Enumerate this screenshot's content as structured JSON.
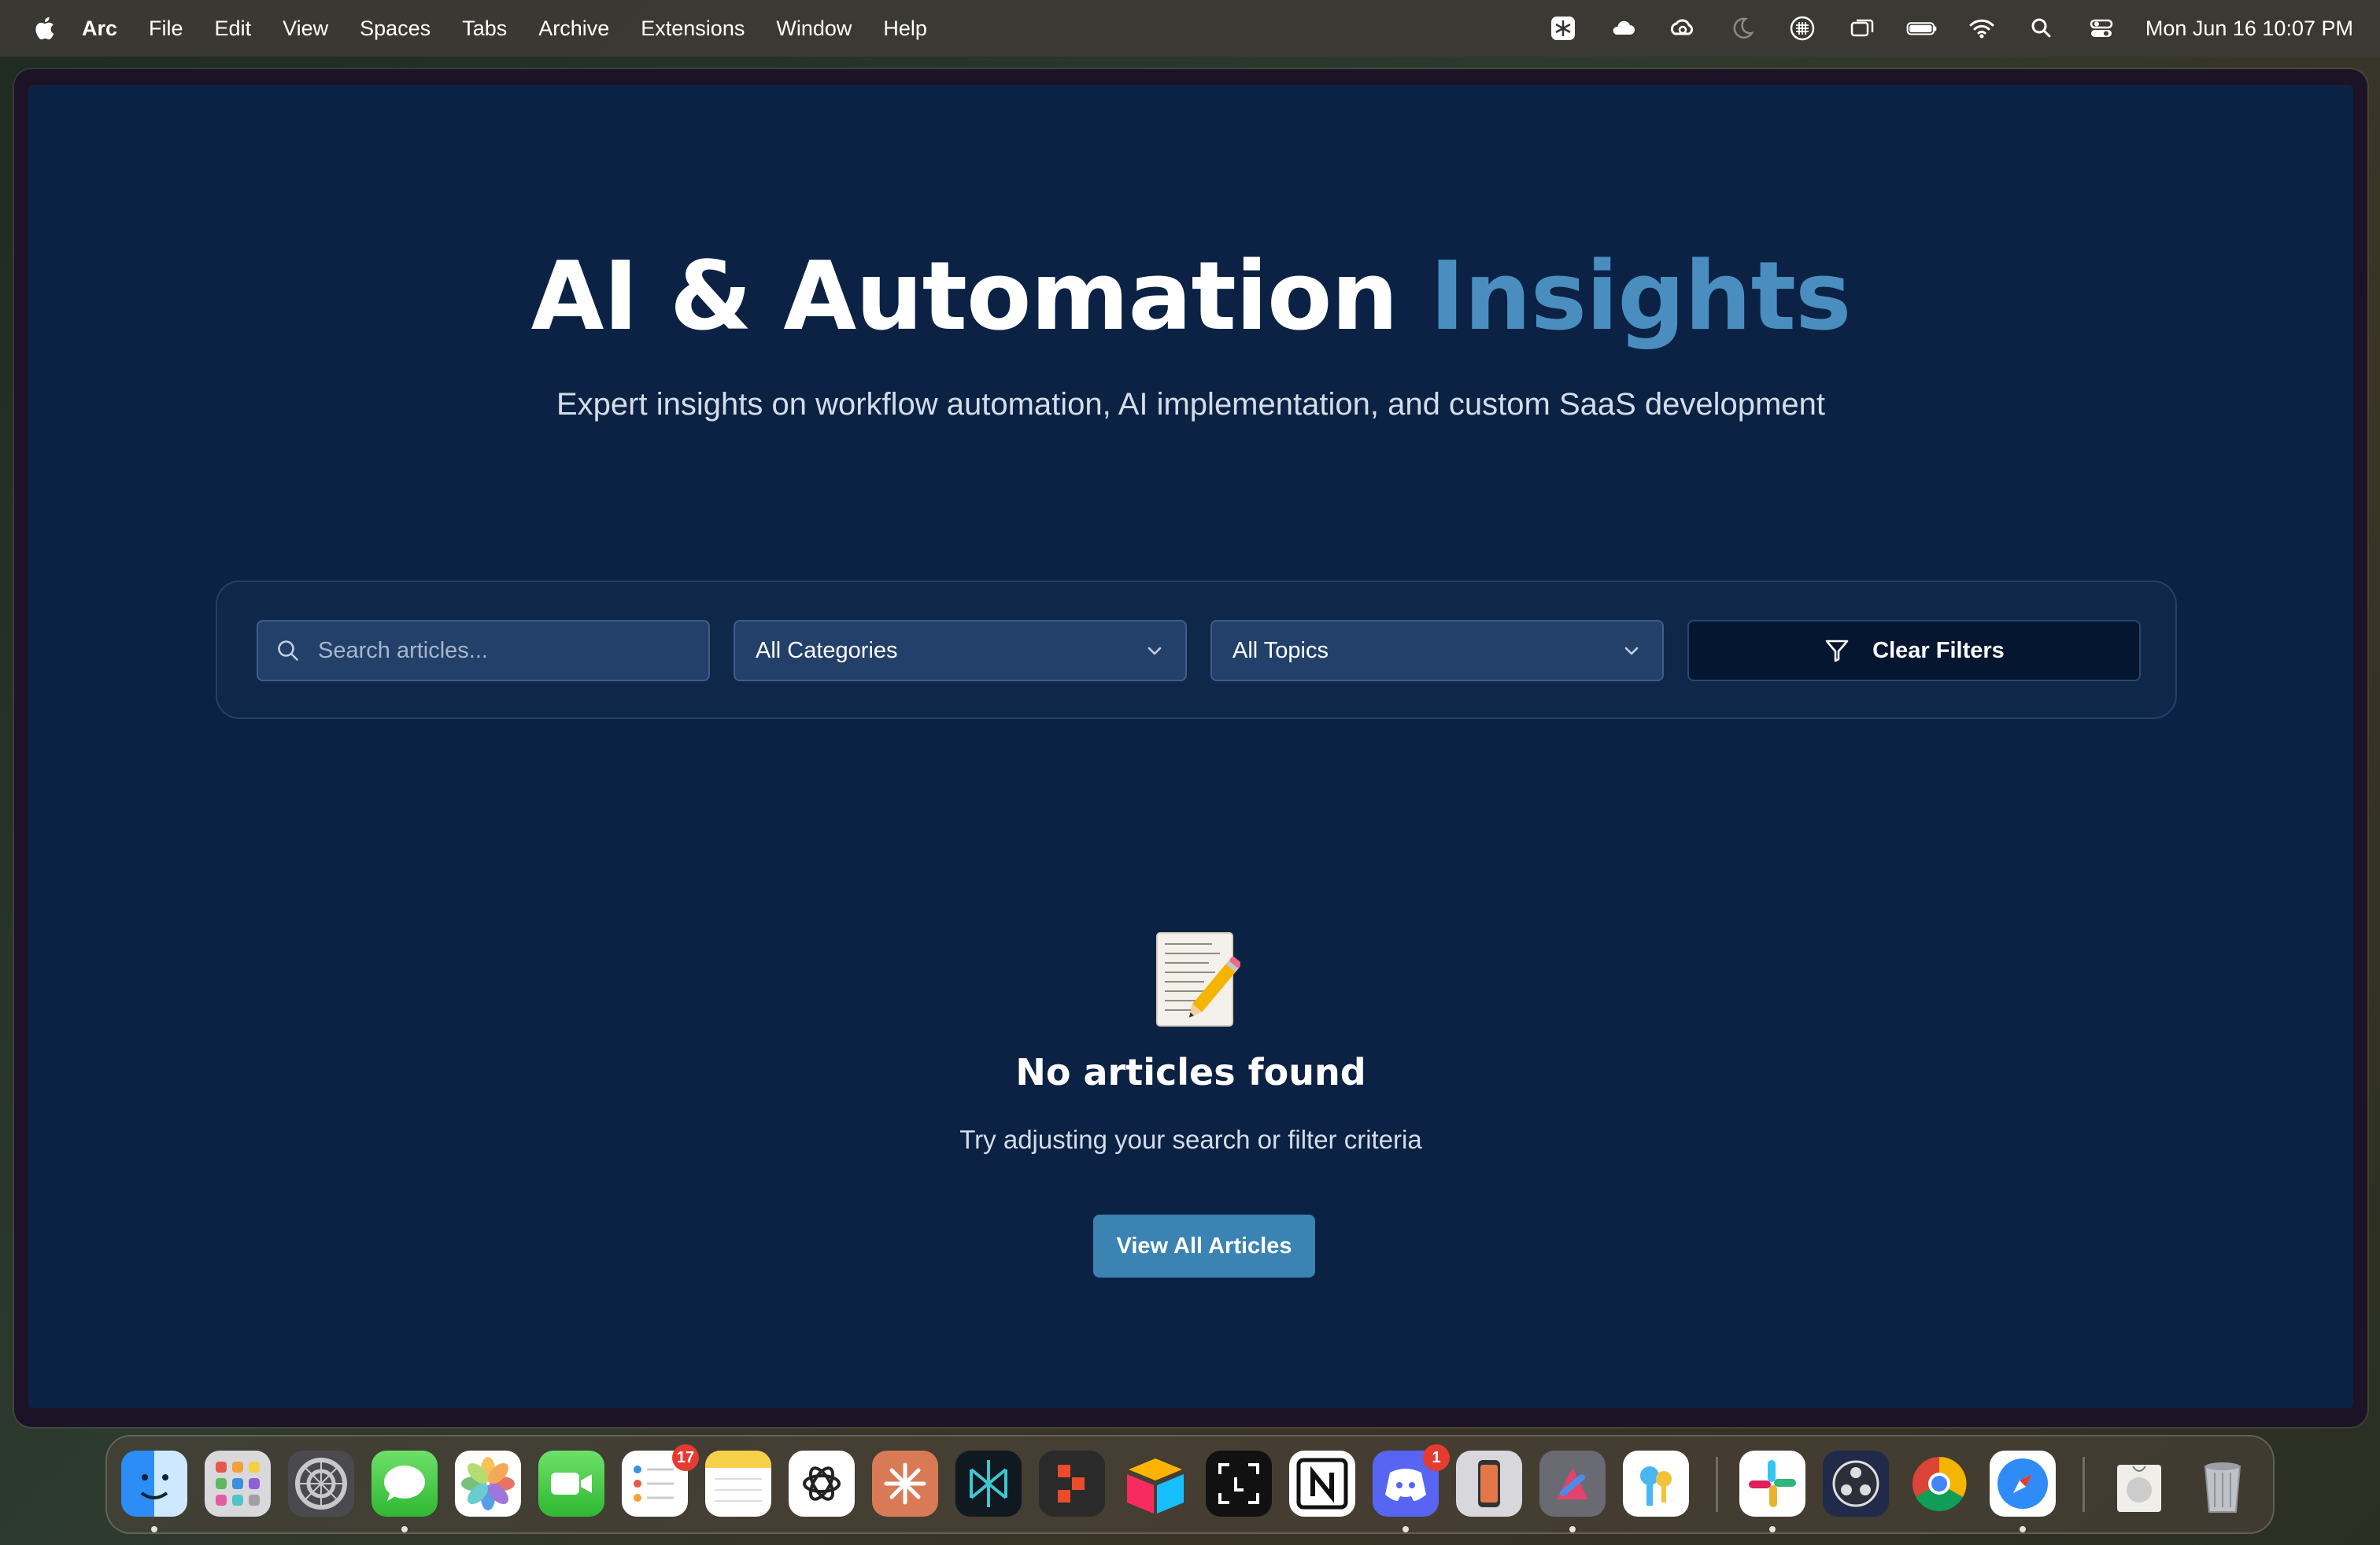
{
  "menubar": {
    "app_name": "Arc",
    "items": [
      "File",
      "Edit",
      "View",
      "Spaces",
      "Tabs",
      "Archive",
      "Extensions",
      "Window",
      "Help"
    ],
    "status_icons": [
      "perplexity-icon",
      "cloud-icon",
      "creative-cloud-icon",
      "moon-icon",
      "grid-icon",
      "window-icon",
      "battery-icon",
      "wifi-icon",
      "search-icon",
      "control-center-icon"
    ],
    "clock": "Mon Jun 16  10:07 PM"
  },
  "hero": {
    "title_main": "AI & Automation",
    "title_accent": "Insights",
    "subtitle": "Expert insights on workflow automation, AI implementation, and custom SaaS development"
  },
  "filters": {
    "search_placeholder": "Search articles...",
    "category_label": "All Categories",
    "topic_label": "All Topics",
    "clear_label": "Clear Filters"
  },
  "empty": {
    "title": "No articles found",
    "subtitle": "Try adjusting your search or filter criteria",
    "button": "View All Articles"
  },
  "dock": {
    "reminders_badge": "17",
    "discord_badge": "1"
  },
  "colors": {
    "page_bg": "#0c2244",
    "accent": "#4a8ec0",
    "button": "#3a83b3"
  }
}
